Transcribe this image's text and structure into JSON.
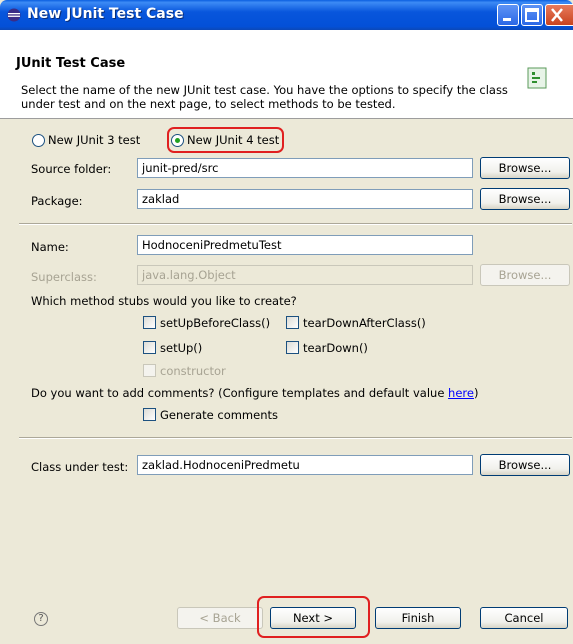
{
  "window": {
    "title": "New JUnit Test Case",
    "icon": "eclipse-icon"
  },
  "header": {
    "title": "JUnit Test Case",
    "description": "Select the name of the new JUnit test case. You have the options to specify the class under test and on the next page, to select methods to be tested.",
    "logo": "junit-logo-icon"
  },
  "version": {
    "junit3_label": "New JUnit 3 test",
    "junit4_label": "New JUnit 4 test",
    "selected": "junit4"
  },
  "source_folder": {
    "label": "Source folder:",
    "value": "junit-pred/src",
    "browse_label": "Browse..."
  },
  "package": {
    "label": "Package:",
    "value": "zaklad",
    "browse_label": "Browse..."
  },
  "name": {
    "label": "Name:",
    "value": "HodnoceniPredmetuTest"
  },
  "superclass": {
    "label": "Superclass:",
    "value": "java.lang.Object",
    "browse_label": "Browse..."
  },
  "stubs": {
    "question": "Which method stubs would you like to create?",
    "setUpBeforeClass": "setUpBeforeClass()",
    "tearDownAfterClass": "tearDownAfterClass()",
    "setUp": "setUp()",
    "tearDown": "tearDown()",
    "constructor": "constructor"
  },
  "comments": {
    "question": "Do you want to add comments? (Configure templates and default value ",
    "link": "here",
    "closing": ")",
    "generate_label": "Generate comments"
  },
  "class_under_test": {
    "label": "Class under test:",
    "value": "zaklad.HodnoceniPredmetu",
    "browse_label": "Browse..."
  },
  "footer": {
    "back_label": "< Back",
    "next_label": "Next >",
    "finish_label": "Finish",
    "cancel_label": "Cancel",
    "help_icon": "help-icon"
  },
  "colors": {
    "titlebar": "#0350d8",
    "highlight": "#e02020",
    "radio_selected": "#21a121",
    "link": "#0000ff"
  }
}
